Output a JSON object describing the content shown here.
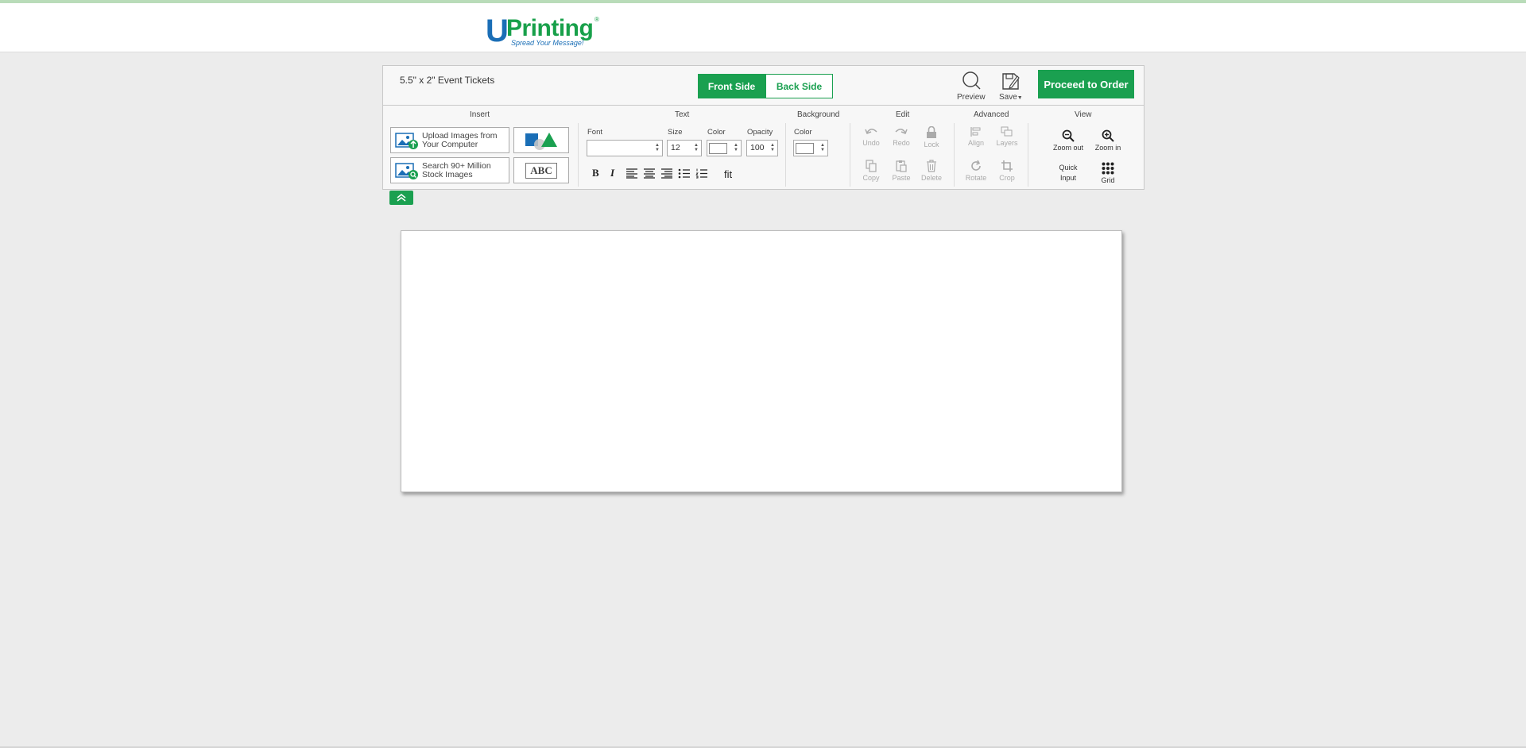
{
  "logo": {
    "letter": "U",
    "name": "Printing",
    "reg": "®",
    "tagline": "Spread Your Message!"
  },
  "toolbar": {
    "product_title": "5.5\" x 2\" Event Tickets",
    "tabs": {
      "front": "Front Side",
      "back": "Back Side"
    },
    "preview_label": "Preview",
    "save_label": "Save",
    "proceed_label": "Proceed to Order"
  },
  "sections": {
    "insert": "Insert",
    "text": "Text",
    "background": "Background",
    "edit": "Edit",
    "advanced": "Advanced",
    "view": "View"
  },
  "insert": {
    "upload_line1": "Upload Images from",
    "upload_line2": "Your Computer",
    "stock_line1": "Search 90+ Million",
    "stock_line2": "Stock Images",
    "text_box": "ABC"
  },
  "text": {
    "font_label": "Font",
    "font_value": "",
    "size_label": "Size",
    "size_value": "12",
    "color_label": "Color",
    "opacity_label": "Opacity",
    "opacity_value": "100",
    "bold": "B",
    "italic": "I",
    "fit": "fit"
  },
  "background": {
    "color_label": "Color"
  },
  "edit": {
    "undo": "Undo",
    "redo": "Redo",
    "lock": "Lock",
    "copy": "Copy",
    "paste": "Paste",
    "delete": "Delete"
  },
  "advanced": {
    "align": "Align",
    "layers": "Layers",
    "rotate": "Rotate",
    "crop": "Crop"
  },
  "view": {
    "zoom_out": "Zoom out",
    "zoom_in": "Zoom in",
    "quick_input_1": "Quick",
    "quick_input_2": "Input",
    "grid": "Grid"
  },
  "colors": {
    "brand_green": "#1aa050",
    "brand_blue": "#1a6eb6",
    "background": "#ececec"
  }
}
